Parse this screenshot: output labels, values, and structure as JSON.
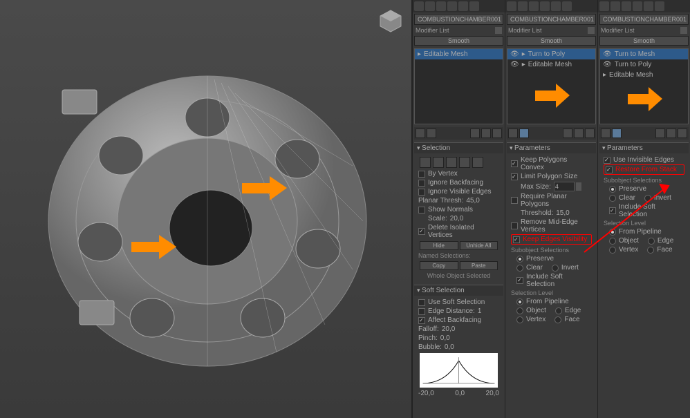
{
  "objectName": "COMBUSTIONCHAMBER001",
  "modifierList": "Modifier List",
  "smooth": "Smooth",
  "stack1": {
    "items": [
      {
        "label": "Editable Mesh",
        "sel": true
      }
    ]
  },
  "stack2": {
    "items": [
      {
        "label": "Turn to Poly",
        "sel": true,
        "eye": true
      },
      {
        "label": "Editable Mesh",
        "sel": false,
        "eye": true
      }
    ]
  },
  "stack3": {
    "items": [
      {
        "label": "Turn to Mesh",
        "sel": true,
        "eye": true
      },
      {
        "label": "Turn to Poly",
        "sel": false,
        "eye": true
      },
      {
        "label": "Editable Mesh",
        "sel": false,
        "eye": true
      }
    ]
  },
  "selection": {
    "header": "Selection",
    "byVertex": "By Vertex",
    "ignoreBackfacing": "Ignore Backfacing",
    "ignoreVisible": "Ignore Visible Edges",
    "planarThresh": "Planar Thresh:",
    "planarVal": "45,0",
    "showNormals": "Show Normals",
    "scale": "Scale:",
    "scaleVal": "20,0",
    "deleteIso": "Delete Isolated Vertices",
    "hide": "Hide",
    "unhideAll": "Unhide All",
    "namedSel": "Named Selections:",
    "copy": "Copy",
    "paste": "Paste",
    "wholeObj": "Whole Object Selected"
  },
  "softSel": {
    "header": "Soft Selection",
    "useSoft": "Use Soft Selection",
    "edgeDist": "Edge Distance:",
    "edgeVal": "1",
    "affectBack": "Affect Backfacing",
    "falloff": "Falloff:",
    "falloffVal": "20,0",
    "pinch": "Pinch:",
    "pinchVal": "0,0",
    "bubble": "Bubble:",
    "bubbleVal": "0,0",
    "axis": [
      "-20,0",
      "0,0",
      "20,0"
    ]
  },
  "params2": {
    "header": "Parameters",
    "keepConvex": "Keep Polygons Convex",
    "limitPoly": "Limit Polygon Size",
    "maxSize": "Max Size:",
    "maxVal": "4",
    "reqPlanar": "Require Planar Polygons",
    "threshold": "Threshold:",
    "threshVal": "15,0",
    "removeMid": "Remove Mid-Edge Vertices",
    "keepEdges": "Keep Edges Visibility",
    "subObj": "Subobject Selections",
    "preserve": "Preserve",
    "clear": "Clear",
    "invert": "Invert",
    "includeSoft": "Include Soft Selection",
    "selLevel": "Selection Level",
    "fromPipe": "From Pipeline",
    "object": "Object",
    "edge": "Edge",
    "vertex": "Vertex",
    "face": "Face"
  },
  "params3": {
    "header": "Parameters",
    "useInvis": "Use Invisible Edges",
    "restore": "Restore From Stack",
    "subObj": "Subobject Selections",
    "preserve": "Preserve",
    "clear": "Clear",
    "invert": "Invert",
    "includeSoft": "Include Soft Selection",
    "selLevel": "Selection Level",
    "fromPipe": "From Pipeline",
    "object": "Object",
    "edge": "Edge",
    "vertex": "Vertex",
    "face": "Face"
  }
}
